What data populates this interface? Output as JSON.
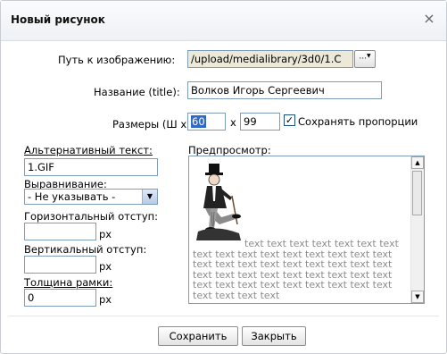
{
  "dialog": {
    "title": "Новый рисунок",
    "close_glyph": "×"
  },
  "form": {
    "path_label": "Путь к изображению:",
    "path_value": "/upload/medialibrary/3d0/1.C",
    "browse_label": "...",
    "title_label": "Название (title):",
    "title_value": "Волков Игорь Сергеевич",
    "size_label": "Размеры (Ш х В):",
    "width_value": "60",
    "times": "x",
    "height_value": "99",
    "keep_proportions_label": "Сохранять пропорции",
    "keep_proportions_checked": true,
    "alt_label": "Альтернативный текст:",
    "alt_value": "1.GIF",
    "align_label": "Выравнивание:",
    "align_value": "- Не указывать -",
    "hspace_label": "Горизонтальный отступ:",
    "hspace_value": "",
    "vspace_label": "Вертикальный отступ:",
    "vspace_value": "",
    "border_label": "Толщина рамки:",
    "border_value": "0",
    "unit": "px"
  },
  "preview": {
    "label": "Предпросмотр:",
    "text": "text text text text text text text text text text text text text text text text text text text text text text text text text text text text text text text text text text text text text text text text text text text text text text text"
  },
  "buttons": {
    "save": "Сохранить",
    "close": "Закрыть"
  },
  "icons": {
    "checkmark": "✓",
    "dropdown": "▼",
    "scroll_up": "▲",
    "scroll_down": "▼"
  }
}
